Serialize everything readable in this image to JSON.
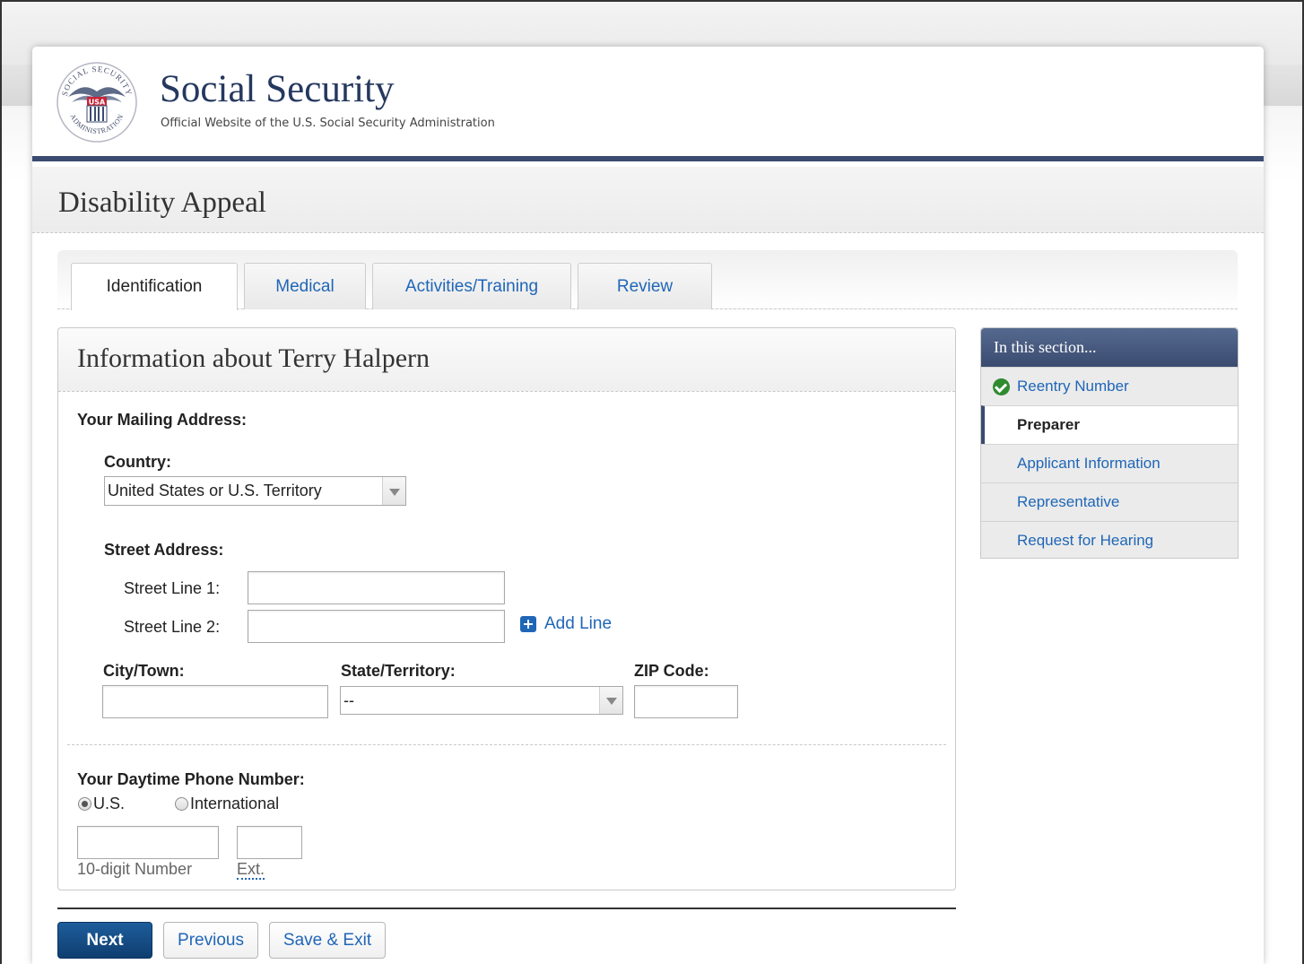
{
  "header": {
    "site_title": "Social Security",
    "site_subtitle": "Official Website of the U.S. Social Security Administration",
    "seal": {
      "top_text": "SOCIAL SECURITY",
      "bottom_text": "ADMINISTRATION",
      "badge": "USA"
    }
  },
  "app": {
    "title": "Disability Appeal"
  },
  "tabs": [
    {
      "label": "Identification",
      "active": true
    },
    {
      "label": "Medical"
    },
    {
      "label": "Activities/Training"
    },
    {
      "label": "Review"
    }
  ],
  "form": {
    "title": "Information about Terry Halpern",
    "mailing_address_label": "Your Mailing Address:",
    "country_label": "Country:",
    "country_value": "United States or U.S. Territory",
    "street_address_label": "Street Address:",
    "street_line1_label": "Street Line 1:",
    "street_line2_label": "Street Line 2:",
    "street_line1_value": "",
    "street_line2_value": "",
    "add_line_label": "Add Line",
    "city_label": "City/Town:",
    "city_value": "",
    "state_label": "State/Territory:",
    "state_value": "--",
    "zip_label": "ZIP Code:",
    "zip_value": "",
    "phone_label": "Your Daytime Phone Number:",
    "phone_type_us": "U.S.",
    "phone_type_intl": "International",
    "phone_type_selected": "U.S.",
    "phone_number_value": "",
    "phone_ext_value": "",
    "phone_number_hint": "10-digit Number",
    "phone_ext_hint": "Ext."
  },
  "buttons": {
    "next": "Next",
    "previous": "Previous",
    "save_exit": "Save & Exit"
  },
  "sidebar": {
    "title": "In this section...",
    "items": [
      {
        "label": "Reentry Number",
        "status": "complete"
      },
      {
        "label": "Preparer",
        "status": "current"
      },
      {
        "label": "Applicant Information"
      },
      {
        "label": "Representative"
      },
      {
        "label": "Request for Hearing"
      }
    ]
  },
  "colors": {
    "brand_navy": "#3b4b70",
    "link_blue": "#1f66b7",
    "primary_button": "#0f3e70",
    "check_green": "#2e8b2e"
  }
}
